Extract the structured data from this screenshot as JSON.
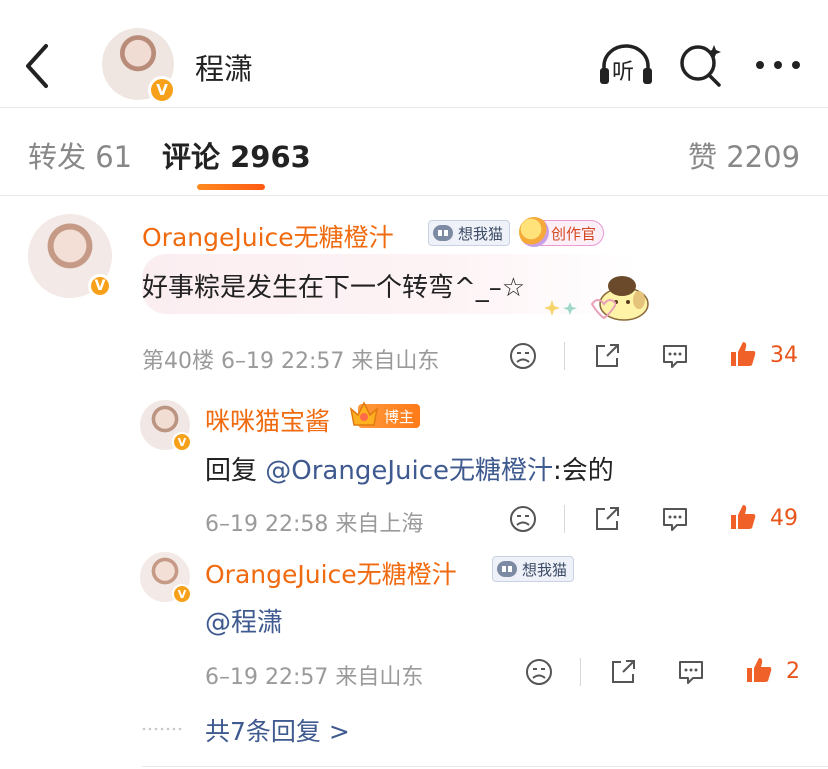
{
  "header": {
    "title": "程潇",
    "listen_label": "听"
  },
  "tabs": [
    {
      "label": "转发",
      "count": "61"
    },
    {
      "label": "评论",
      "count": "2963"
    },
    {
      "label": "赞",
      "count": "2209"
    }
  ],
  "comments": [
    {
      "username": "OrangeJuice无糖橙汁",
      "tag": "想我猫",
      "creator_tag": "创作官",
      "content": "好事粽是发生在下一个转弯^_–☆",
      "meta": "第40楼 6–19 22:57 来自山东",
      "likes": "34",
      "replies": [
        {
          "username": "咪咪猫宝酱",
          "blogger_tag": "博主",
          "content_prefix": "回复 ",
          "content_mention": "@OrangeJuice无糖橙汁",
          "content_suffix": ":会的",
          "meta": "6–19 22:58 来自上海",
          "likes": "49"
        },
        {
          "username": "OrangeJuice无糖橙汁",
          "tag": "想我猫",
          "content_mention": "@程潇",
          "meta": "6–19 22:57 来自山东",
          "likes": "2"
        }
      ],
      "more_replies": "共7条回复 >"
    }
  ],
  "colors": {
    "accent": "#f06a0f",
    "mention": "#3f5a8f",
    "like": "#e8541a",
    "badge": "#f7a11a"
  }
}
